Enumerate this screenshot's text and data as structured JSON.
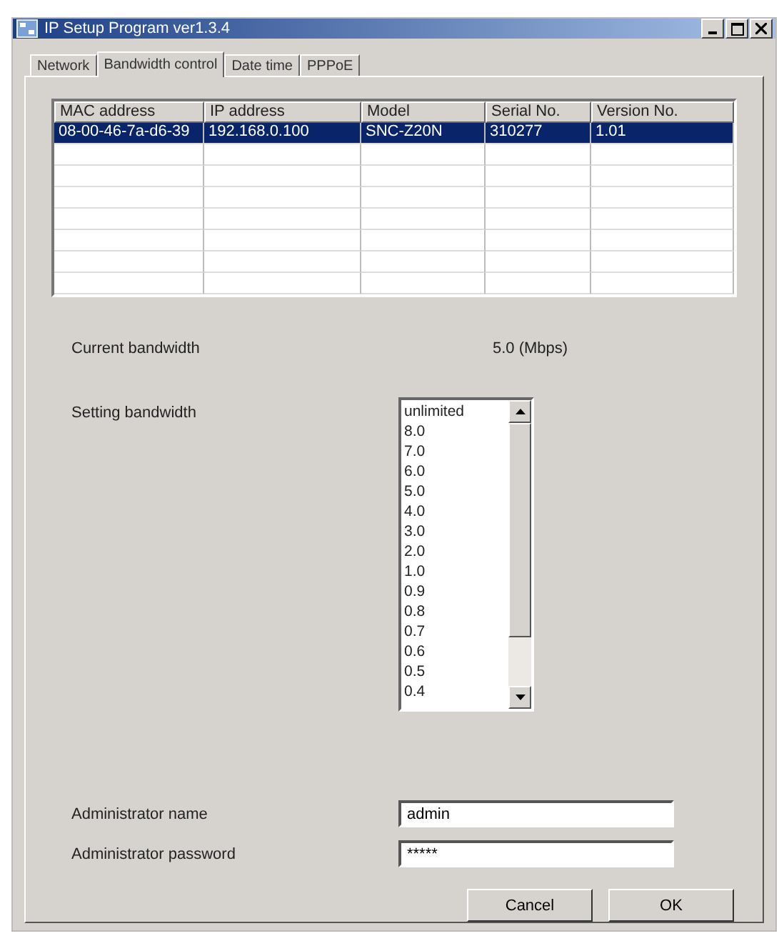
{
  "window": {
    "title": "IP Setup Program ver1.3.4"
  },
  "tabs": [
    {
      "label": "Network",
      "selected": false
    },
    {
      "label": "Bandwidth control",
      "selected": true
    },
    {
      "label": "Date time",
      "selected": false
    },
    {
      "label": "PPPoE",
      "selected": false
    }
  ],
  "table": {
    "columns": [
      "MAC address",
      "IP address",
      "Model",
      "Serial No.",
      "Version No."
    ],
    "rows": [
      {
        "cells": [
          "08-00-46-7a-d6-39",
          "192.168.0.100",
          "SNC-Z20N",
          "310277",
          "1.01"
        ],
        "selected": true
      }
    ]
  },
  "current_bandwidth": {
    "label": "Current bandwidth",
    "value": "5.0  (Mbps)"
  },
  "setting_bandwidth": {
    "label": "Setting bandwidth",
    "options": [
      "unlimited",
      "8.0",
      "7.0",
      "6.0",
      "5.0",
      "4.0",
      "3.0",
      "2.0",
      "1.0",
      "0.9",
      "0.8",
      "0.7",
      "0.6",
      "0.5",
      "0.4"
    ]
  },
  "admin_name": {
    "label": "Administrator name",
    "value": "admin"
  },
  "admin_password": {
    "label": "Administrator password",
    "value": "*****"
  },
  "buttons": [
    "Cancel",
    "OK"
  ]
}
